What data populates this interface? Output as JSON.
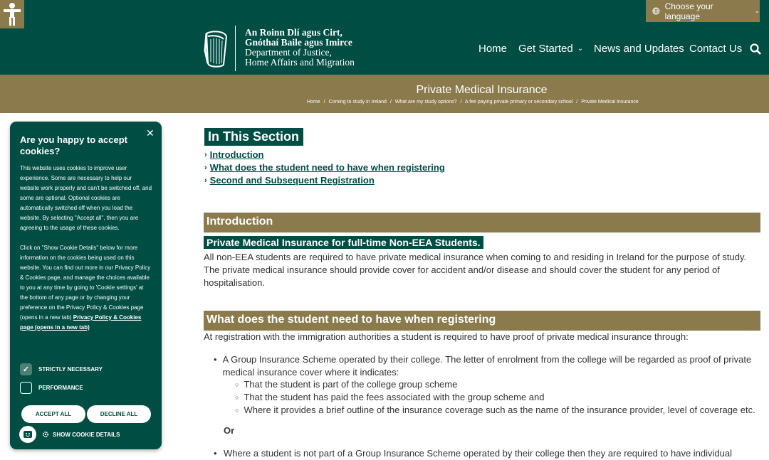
{
  "topbar": {
    "language_label": "Choose your language"
  },
  "header": {
    "logo_lines": [
      "An Roinn Dlí agus Cirt,",
      "Gnóthaí Baile agus Imirce",
      "Department of Justice,",
      "Home Affairs and Migration"
    ],
    "nav": {
      "home": "Home",
      "get_started": "Get Started",
      "news": "News and Updates",
      "contact": "Contact Us"
    }
  },
  "titleband": {
    "title": "Private Medical Insurance",
    "breadcrumb": [
      "Home",
      "/",
      "Coming to study in Ireland",
      "/",
      "What are my study options?",
      "/",
      "A fee paying private primary or secondary school",
      "/",
      "Private Medical Insurance"
    ]
  },
  "content": {
    "in_section_heading": "In This Section",
    "section_links": [
      "Introduction",
      "What does the student need to have when registering",
      "Second and Subsequent Registration"
    ],
    "intro_heading": "Introduction",
    "intro_subheading": "Private Medical Insurance for full-time Non-EEA Students.",
    "intro_paragraph": "All non-EEA students are required to have private medical insurance when coming to and residing in Ireland for the purpose of study. The private medical insurance should provide cover for accident and/or disease and should cover the student for any period of hospitalisation.",
    "register_heading": "What does the student need to have when registering",
    "register_paragraph": "At registration with the immigration authorities a student is required to have proof of private medical insurance through:",
    "bullet_1": "A Group Insurance Scheme operated by their college. The letter of enrolment from the college will be regarded as proof of private medical insurance cover where it indicates:",
    "sub_bullets": [
      "That the student is part of the college group scheme",
      "That the student has paid the fees associated with the group scheme and",
      "Where it provides a brief outline of the insurance coverage such as the name of the insurance provider, level of coverage etc."
    ],
    "or_text": "Or",
    "bullet_2": "Where a student is not part of a Group Insurance Scheme operated by their college then they are required to have individual"
  },
  "cookie": {
    "title": "Are you happy to accept cookies?",
    "para_1": "This website uses cookies to improve user experience. Some are necessary to help our website work properly and can't be switched off, and some are optional. Optional cookies are automatically switched off when you load the website. By selecting \"Accept all\", then you are agreeing to the usage of these cookies.",
    "para_2": "Click on \"Show Cookie Details\" below for more information on the cookies being used on this website. You can find out more in our Privacy Policy & Cookies page, and manage the choices available to you at any time by going to 'Cookie settings' at the bottom of any page or by changing your preference on the Privacy Policy & Cookies page (opens in a new tab)",
    "para_2_link": "Privacy Policy & Cookies page (opens in a new tab)",
    "strictly_necessary": "STRICTLY NECESSARY",
    "performance": "PERFORMANCE",
    "accept_all": "ACCEPT ALL",
    "decline_all": "DECLINE ALL",
    "show_details": "SHOW COOKIE DETAILS"
  }
}
